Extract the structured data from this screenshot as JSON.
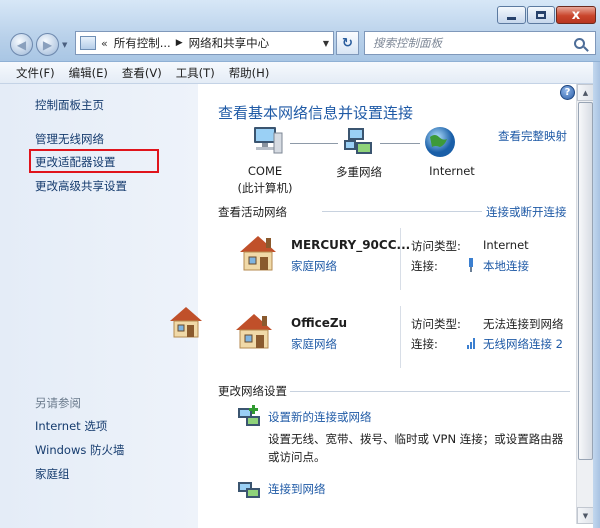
{
  "window": {
    "caption_min": "—",
    "caption_max": "□",
    "caption_close": "x"
  },
  "address": {
    "prefix": "«",
    "crumbs": [
      "所有控制...",
      "网络和共享中心"
    ],
    "sep": "▶"
  },
  "search": {
    "placeholder": "搜索控制面板"
  },
  "menu": [
    "文件(F)",
    "编辑(E)",
    "查看(V)",
    "工具(T)",
    "帮助(H)"
  ],
  "sidebar": {
    "items": [
      {
        "label": "控制面板主页"
      },
      {
        "label": "管理无线网络"
      },
      {
        "label": "更改适配器设置"
      },
      {
        "label": "更改高级共享设置"
      }
    ],
    "see_also_title": "另请参阅",
    "see_also": [
      {
        "label": "Internet 选项"
      },
      {
        "label": "Windows 防火墙"
      },
      {
        "label": "家庭组"
      }
    ]
  },
  "main": {
    "heading": "查看基本网络信息并设置连接",
    "view_full_map": "查看完整映射",
    "map": {
      "computer_name": "COME",
      "computer_sub": "(此计算机)",
      "middle": "多重网络",
      "internet": "Internet"
    },
    "active_title": "查看活动网络",
    "connect_disconnect": "连接或断开连接",
    "networks": [
      {
        "name": "MERCURY_90CC...",
        "type": "家庭网络",
        "access_label": "访问类型:",
        "access_value": "Internet",
        "conn_label": "连接:",
        "conn_value": "本地连接"
      },
      {
        "name": "OfficeZu",
        "type": "家庭网络",
        "access_label": "访问类型:",
        "access_value": "无法连接到网络",
        "conn_label": "连接:",
        "conn_value": "无线网络连接 2"
      }
    ],
    "change_title": "更改网络设置",
    "tasks": [
      {
        "label": "设置新的连接或网络",
        "desc": "设置无线、宽带、拨号、临时或 VPN 连接；或设置路由器或访问点。"
      },
      {
        "label": "连接到网络"
      }
    ]
  },
  "help_label": "?"
}
